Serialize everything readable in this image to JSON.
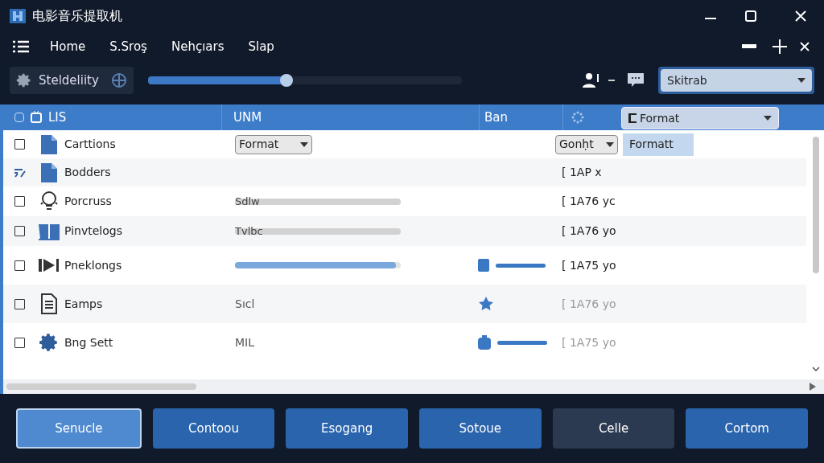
{
  "window": {
    "title": "电影音乐提取机"
  },
  "menu": [
    {
      "label": "Home"
    },
    {
      "label": "S.Sroş"
    },
    {
      "label": "Nehçıars"
    },
    {
      "label": "Slap"
    }
  ],
  "toolbar": {
    "profile": {
      "label": "Steldeliity"
    },
    "slider": {
      "level": 0.44
    },
    "dropdown": {
      "value": "Skitrab"
    }
  },
  "table": {
    "header_checked": false,
    "columns": [
      {
        "label": "LIS"
      },
      {
        "label": "UNM"
      },
      {
        "label": "Ban"
      }
    ],
    "format_dropdown": {
      "value": "Format"
    },
    "rows": [
      {
        "checked": false,
        "kind": "file",
        "name": "Carttions",
        "col2": {
          "kind": "select",
          "value": "Format"
        },
        "col3": {
          "kind": "none"
        },
        "col4": {
          "kind": "select",
          "value": "Gonḥt",
          "option": "Formatt"
        }
      },
      {
        "checked": true,
        "kind": "file",
        "name": "Bodders",
        "col2": {
          "kind": "none"
        },
        "col3": {
          "kind": "none"
        },
        "col4": {
          "kind": "text",
          "text": "[ 1AP x"
        }
      },
      {
        "checked": false,
        "kind": "bulb",
        "name": "Porcruss",
        "col2": {
          "kind": "bar",
          "text": "Sdlw",
          "level": 1,
          "active": false
        },
        "col3": {
          "kind": "none"
        },
        "col4": {
          "kind": "text",
          "text": "[ 1A76 yc"
        }
      },
      {
        "checked": false,
        "kind": "folder",
        "name": "Pinvtelogs",
        "col2": {
          "kind": "bar",
          "text": "Tvlbc",
          "level": 1,
          "active": false
        },
        "col3": {
          "kind": "none"
        },
        "col4": {
          "kind": "text",
          "text": "[ 1A76 yo"
        }
      },
      {
        "checked": false,
        "kind": "clapper",
        "name": "Pneklongs",
        "col2": {
          "kind": "bar",
          "level": 0.97,
          "active": true
        },
        "col3": {
          "kind": "square"
        },
        "col4": {
          "kind": "text",
          "text": "[ 1A75 yo"
        }
      },
      {
        "checked": false,
        "kind": "list",
        "name": "Eamps",
        "col2": {
          "kind": "text",
          "text": "Sıcl"
        },
        "col3": {
          "kind": "star"
        },
        "col4": {
          "kind": "text",
          "text": "[ 1A76 yo"
        }
      },
      {
        "checked": false,
        "kind": "gear",
        "name": "Bng Sett",
        "col2": {
          "kind": "text",
          "text": "MIL"
        },
        "col3": {
          "kind": "jar"
        },
        "col4": {
          "kind": "text",
          "text": "[ 1A75 yo"
        }
      }
    ]
  },
  "buttons": [
    {
      "label": "Senucle",
      "selected": true,
      "disabled": false
    },
    {
      "label": "Contoou",
      "selected": false,
      "disabled": false
    },
    {
      "label": "Esogang",
      "selected": false,
      "disabled": false
    },
    {
      "label": "Sotoue",
      "selected": false,
      "disabled": false
    },
    {
      "label": "Celle",
      "selected": false,
      "disabled": true
    },
    {
      "label": "Cortom",
      "selected": false,
      "disabled": false
    }
  ]
}
